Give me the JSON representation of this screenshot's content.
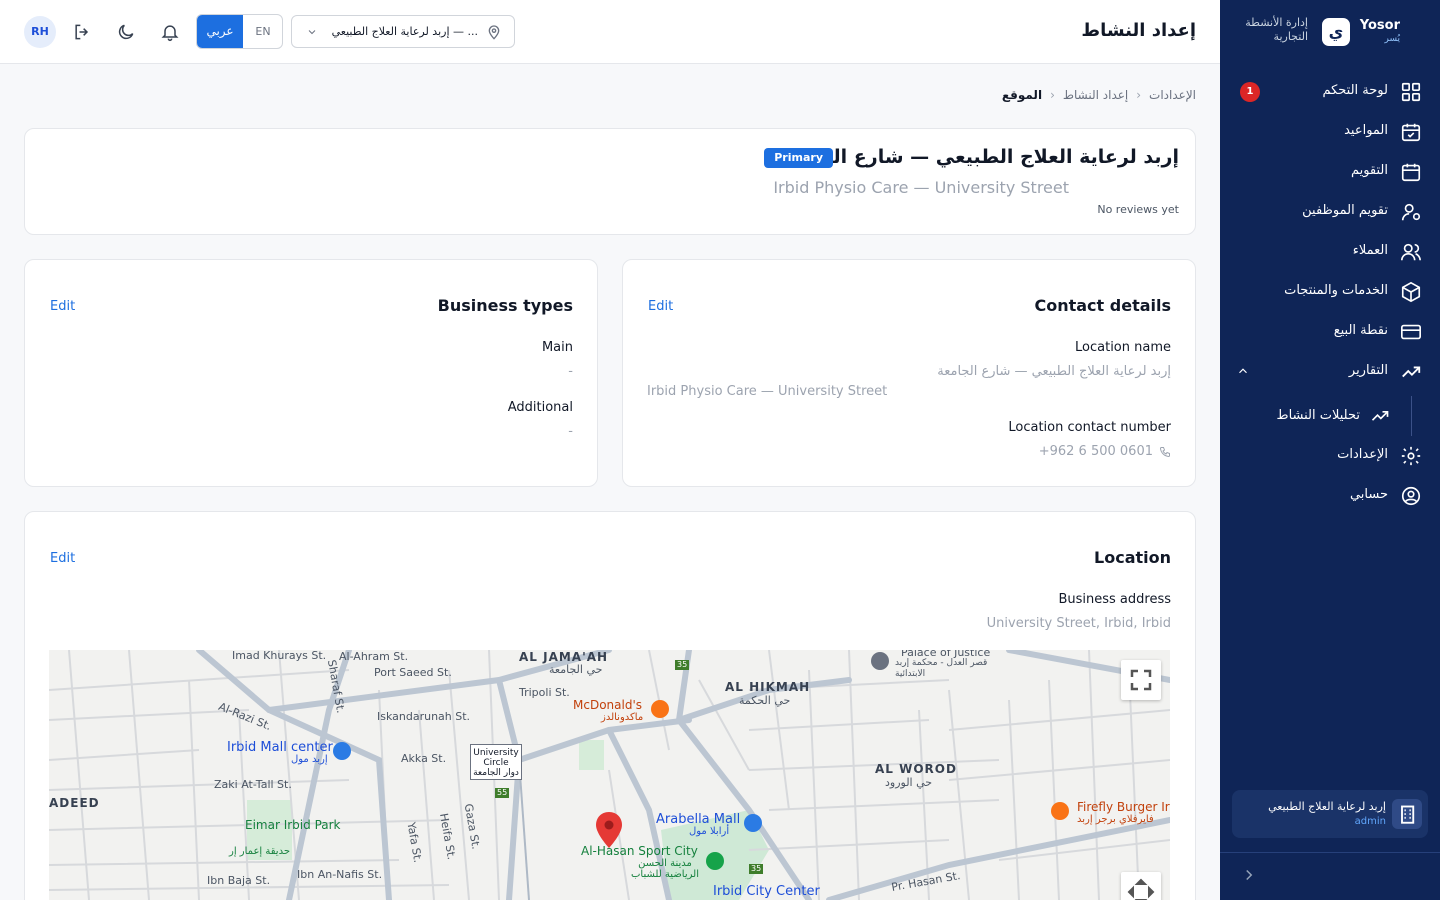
{
  "app": {
    "brand_name": "Yosor",
    "brand_ar": "يُسر",
    "brand_logo": "ي",
    "brand_subtitle": "إدارة الأنشطة التجارية",
    "colors": {
      "sidebar": "#0f2557",
      "accent": "#1d6fe0",
      "badge": "#dc2626"
    }
  },
  "sidebar": {
    "items": [
      {
        "label": "لوحة التحكم",
        "icon": "dashboard-icon",
        "badge": "1"
      },
      {
        "label": "المواعيد",
        "icon": "calendar-check-icon"
      },
      {
        "label": "التقويم",
        "icon": "calendar-icon"
      },
      {
        "label": "تقويم الموظفين",
        "icon": "user-gear-icon"
      },
      {
        "label": "العملاء",
        "icon": "users-icon"
      },
      {
        "label": "الخدمات والمنتجات",
        "icon": "box-icon"
      },
      {
        "label": "نقطة البيع",
        "icon": "credit-card-icon"
      },
      {
        "label": "التقارير",
        "icon": "trend-up-icon",
        "expanded": true
      },
      {
        "label": "الإعدادات",
        "icon": "gear-icon"
      },
      {
        "label": "حسابي",
        "icon": "user-circle-icon"
      }
    ],
    "sub_items": [
      {
        "label": "تحليلات النشاط",
        "icon": "trend-up-icon"
      }
    ],
    "business": {
      "name": "إربد لرعاية العلاج الطبيعي",
      "role": "admin"
    }
  },
  "topbar": {
    "title": "إعداد النشاط",
    "location_select": "إربد لرعاية العلاج الطبيعي — ...",
    "lang_ar": "عربي",
    "lang_en": "EN",
    "avatar": "RH"
  },
  "breadcrumb": [
    "الإعدادات",
    "إعداد النشاط",
    "الموقع"
  ],
  "hero": {
    "title_ar": "إربد لرعاية العلاج الطبيعي — شارع الجامعة",
    "badge": "Primary",
    "title_en": "Irbid Physio Care — University Street",
    "reviews": "No reviews yet"
  },
  "business_types": {
    "title": "Business types",
    "edit": "Edit",
    "main_label": "Main",
    "main_value": "-",
    "additional_label": "Additional",
    "additional_value": "-"
  },
  "contact": {
    "title": "Contact details",
    "edit": "Edit",
    "name_label": "Location name",
    "name_ar": "إربد لرعاية العلاج الطبيعي — شارع الجامعة",
    "name_en": "Irbid Physio Care — University Street",
    "phone_label": "Location contact number",
    "phone": "+962 6 500 0601"
  },
  "location": {
    "title": "Location",
    "edit": "Edit",
    "address_label": "Business address",
    "address": "University Street, Irbid, Irbid"
  },
  "map_labels": {
    "al_jamaah": "AL JAMA'AH",
    "al_jamaah_ar": "حي الجامعة",
    "al_hikmah": "AL HIKMAH",
    "al_hikmah_ar": "حي الحكمة",
    "al_word": "AL WOROD",
    "al_word_ar": "حي الورود",
    "adeed": "ADEED",
    "mcdonalds": "McDonald's",
    "mcdonalds_ar": "ماكدونالدز",
    "irbid_mall": "Irbid Mall center",
    "irbid_mall_ar": "إربد مول",
    "arabella": "Arabella Mall",
    "arabella_ar": "أرابلا مول",
    "sport_city": "Al-Hasan Sport City",
    "sport_city_ar": "مدينة الحسن الرياضية للشباب",
    "eimar": "Eimar Irbid Park",
    "eimar_ar": "حديقة إعمار إر",
    "irbid_city": "Irbid City Center",
    "firefly": "Firefly Burger Ir",
    "firefly_ar": "فايرفلاي برجر إربد",
    "palace": "Palace of Justice",
    "palace_ar": "قصر العدل - محكمة إربد الابتدائية",
    "circle": "University Circle",
    "circle_ar": "دوار الجامعة",
    "imad": "Imad Khurays St.",
    "alahram": "Al-Ahram St.",
    "portsaeed": "Port Saeed St.",
    "tripoli": "Tripoli St.",
    "iskandarunah": "Iskandarunah St.",
    "alrazi": "Al-Razi St.",
    "akka": "Akka St.",
    "zaki": "Zaki At-Tall St.",
    "sharaf": "Sharaf St.",
    "gaza": "Gaza St.",
    "yafa": "Yafa St.",
    "heifa": "Heifa St.",
    "ibnbaja": "Ibn Baja St.",
    "ibnannafis": "Ibn An-Nafis St.",
    "prhasan": "Pr. Hasan St.",
    "r35": "35",
    "r55": "55"
  }
}
